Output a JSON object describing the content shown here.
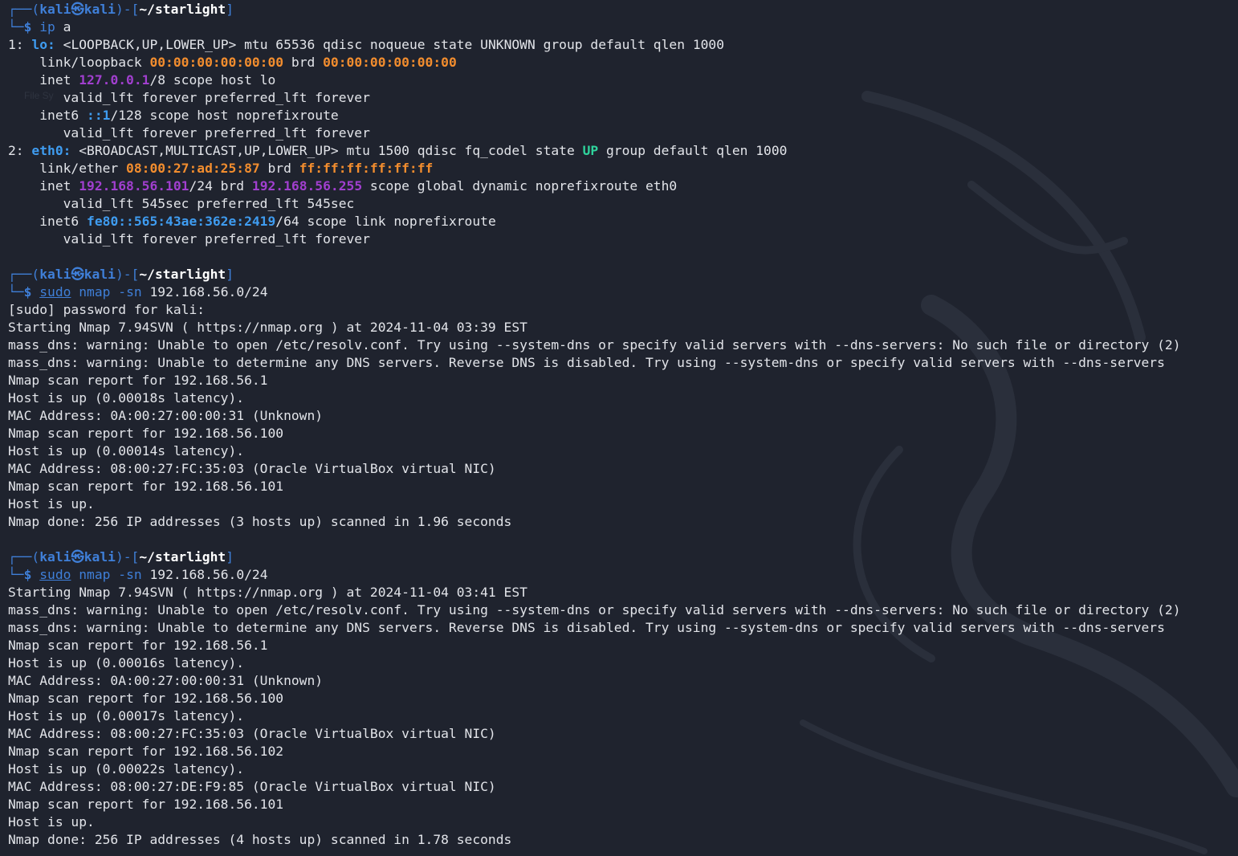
{
  "prompt": {
    "open": "┌──(",
    "user": "kali",
    "skull": "㉿",
    "host": "kali",
    "mid": ")-[",
    "path": "~/starlight",
    "close": "]",
    "corner": "└─",
    "dollar": "$"
  },
  "watermark": "File Sy",
  "blocks": [
    {
      "command": {
        "sudo": "",
        "exe": "ip",
        "args": " a"
      },
      "lines": [
        [
          {
            "t": "1: "
          },
          {
            "t": "lo:",
            "c": "ifname"
          },
          {
            "t": " <LOOPBACK,UP,LOWER_UP> mtu 65536 qdisc noqueue state UNKNOWN group default qlen 1000"
          }
        ],
        [
          {
            "t": "    link/loopback "
          },
          {
            "t": "00:00:00:00:00:00",
            "c": "mac"
          },
          {
            "t": " brd "
          },
          {
            "t": "00:00:00:00:00:00",
            "c": "mac"
          }
        ],
        [
          {
            "t": "    inet "
          },
          {
            "t": "127.0.0.1",
            "c": "ip4"
          },
          {
            "t": "/8 scope host lo"
          }
        ],
        [
          {
            "t": "       valid_lft forever preferred_lft forever"
          }
        ],
        [
          {
            "t": "    inet6 "
          },
          {
            "t": "::1",
            "c": "ip6"
          },
          {
            "t": "/128 scope host noprefixroute"
          }
        ],
        [
          {
            "t": "       valid_lft forever preferred_lft forever"
          }
        ],
        [
          {
            "t": "2: "
          },
          {
            "t": "eth0:",
            "c": "ifname"
          },
          {
            "t": " <BROADCAST,MULTICAST,UP,LOWER_UP> mtu 1500 qdisc fq_codel state "
          },
          {
            "t": "UP",
            "c": "up"
          },
          {
            "t": " group default qlen 1000"
          }
        ],
        [
          {
            "t": "    link/ether "
          },
          {
            "t": "08:00:27:ad:25:87",
            "c": "mac"
          },
          {
            "t": " brd "
          },
          {
            "t": "ff:ff:ff:ff:ff:ff",
            "c": "mac"
          }
        ],
        [
          {
            "t": "    inet "
          },
          {
            "t": "192.168.56.101",
            "c": "ip4"
          },
          {
            "t": "/24 brd "
          },
          {
            "t": "192.168.56.255",
            "c": "ip4"
          },
          {
            "t": " scope global dynamic noprefixroute eth0"
          }
        ],
        [
          {
            "t": "       valid_lft 545sec preferred_lft 545sec"
          }
        ],
        [
          {
            "t": "    inet6 "
          },
          {
            "t": "fe80::565:43ae:362e:2419",
            "c": "ip6"
          },
          {
            "t": "/64 scope link noprefixroute"
          }
        ],
        [
          {
            "t": "       valid_lft forever preferred_lft forever"
          }
        ]
      ]
    },
    {
      "command": {
        "sudo": "sudo",
        "exe": " nmap",
        "args": " 192.168.56.0/24",
        "flag": " -sn"
      },
      "lines": [
        [
          {
            "t": "[sudo] password for kali:"
          }
        ],
        [
          {
            "t": "Starting Nmap 7.94SVN ( https://nmap.org ) at 2024-11-04 03:39 EST"
          }
        ],
        [
          {
            "t": "mass_dns: warning: Unable to open /etc/resolv.conf. Try using --system-dns or specify valid servers with --dns-servers: No such file or directory (2)"
          }
        ],
        [
          {
            "t": "mass_dns: warning: Unable to determine any DNS servers. Reverse DNS is disabled. Try using --system-dns or specify valid servers with --dns-servers"
          }
        ],
        [
          {
            "t": "Nmap scan report for 192.168.56.1"
          }
        ],
        [
          {
            "t": "Host is up (0.00018s latency)."
          }
        ],
        [
          {
            "t": "MAC Address: 0A:00:27:00:00:31 (Unknown)"
          }
        ],
        [
          {
            "t": "Nmap scan report for 192.168.56.100"
          }
        ],
        [
          {
            "t": "Host is up (0.00014s latency)."
          }
        ],
        [
          {
            "t": "MAC Address: 08:00:27:FC:35:03 (Oracle VirtualBox virtual NIC)"
          }
        ],
        [
          {
            "t": "Nmap scan report for 192.168.56.101"
          }
        ],
        [
          {
            "t": "Host is up."
          }
        ],
        [
          {
            "t": "Nmap done: 256 IP addresses (3 hosts up) scanned in 1.96 seconds"
          }
        ]
      ]
    },
    {
      "command": {
        "sudo": "sudo",
        "exe": " nmap",
        "args": " 192.168.56.0/24",
        "flag": " -sn"
      },
      "lines": [
        [
          {
            "t": "Starting Nmap 7.94SVN ( https://nmap.org ) at 2024-11-04 03:41 EST"
          }
        ],
        [
          {
            "t": "mass_dns: warning: Unable to open /etc/resolv.conf. Try using --system-dns or specify valid servers with --dns-servers: No such file or directory (2)"
          }
        ],
        [
          {
            "t": "mass_dns: warning: Unable to determine any DNS servers. Reverse DNS is disabled. Try using --system-dns or specify valid servers with --dns-servers"
          }
        ],
        [
          {
            "t": "Nmap scan report for 192.168.56.1"
          }
        ],
        [
          {
            "t": "Host is up (0.00016s latency)."
          }
        ],
        [
          {
            "t": "MAC Address: 0A:00:27:00:00:31 (Unknown)"
          }
        ],
        [
          {
            "t": "Nmap scan report for 192.168.56.100"
          }
        ],
        [
          {
            "t": "Host is up (0.00017s latency)."
          }
        ],
        [
          {
            "t": "MAC Address: 08:00:27:FC:35:03 (Oracle VirtualBox virtual NIC)"
          }
        ],
        [
          {
            "t": "Nmap scan report for 192.168.56.102"
          }
        ],
        [
          {
            "t": "Host is up (0.00022s latency)."
          }
        ],
        [
          {
            "t": "MAC Address: 08:00:27:DE:F9:85 (Oracle VirtualBox virtual NIC)"
          }
        ],
        [
          {
            "t": "Nmap scan report for 192.168.56.101"
          }
        ],
        [
          {
            "t": "Host is up."
          }
        ],
        [
          {
            "t": "Nmap done: 256 IP addresses (4 hosts up) scanned in 1.78 seconds"
          }
        ]
      ]
    }
  ]
}
